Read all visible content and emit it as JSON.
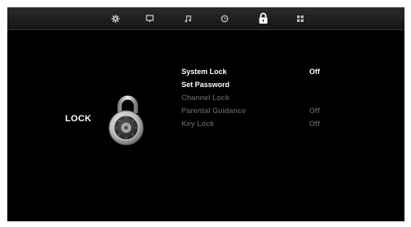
{
  "topbar": {
    "tabs": [
      {
        "icon": "settings-gear-icon"
      },
      {
        "icon": "screen-icon"
      },
      {
        "icon": "music-note-icon"
      },
      {
        "icon": "clock-icon"
      },
      {
        "icon": "lock-icon",
        "selected": true
      },
      {
        "icon": "apps-grid-icon"
      }
    ]
  },
  "section": {
    "title": "LOCK"
  },
  "menu": {
    "items": [
      {
        "label": "System Lock",
        "value": "Off",
        "enabled": true
      },
      {
        "label": "Set Password",
        "value": "",
        "enabled": true
      },
      {
        "label": "Channel Lock",
        "value": "",
        "enabled": false
      },
      {
        "label": "Parental Guidance",
        "value": "Off",
        "enabled": false
      },
      {
        "label": "Key Lock",
        "value": "Off",
        "enabled": false
      }
    ]
  },
  "colors": {
    "background": "#000000",
    "enabled_text": "#ffffff",
    "disabled_text": "#555555",
    "topbar": "#202020"
  }
}
